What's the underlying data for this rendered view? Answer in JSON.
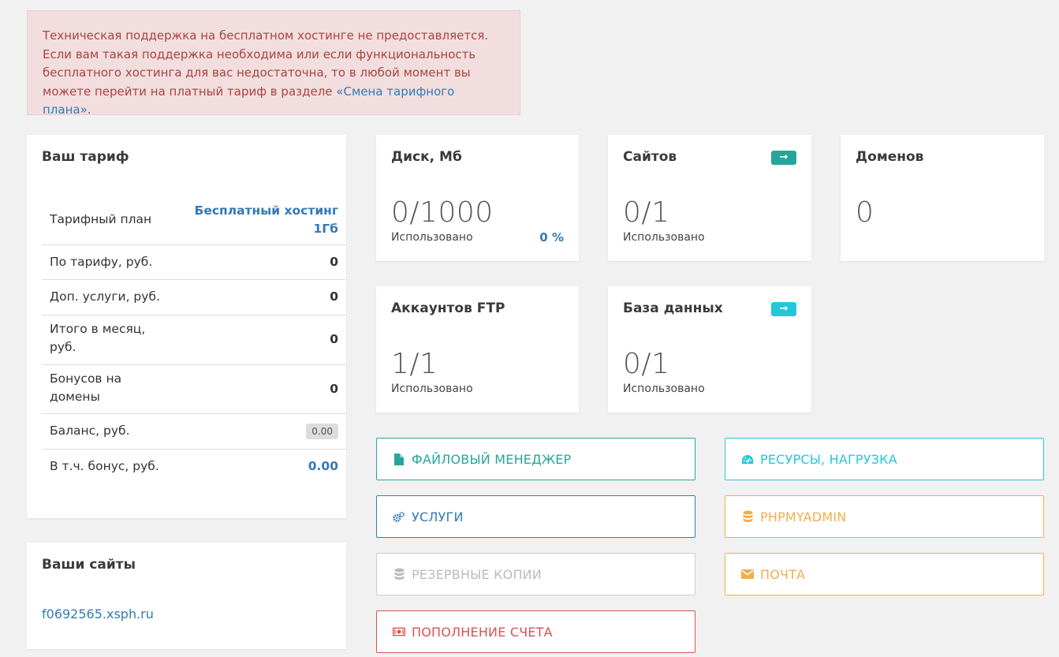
{
  "alert": {
    "line1": "Техническая поддержка на бесплатном хостинге не предоставляется.",
    "line2": "Если вам такая поддержка необходима или если функциональность",
    "line3": "бесплатного хостинга для вас недостаточна, то в любой момент вы",
    "line4_prefix": "можете перейти на платный тариф в разделе ",
    "line4_link": "«Смена тарифного плана»",
    "line4_suffix": "."
  },
  "tariff": {
    "title": "Ваш тариф",
    "plan_label": "Тарифный план",
    "plan_value_line1": "Бесплатный хостинг",
    "plan_value_line2": "1Гб",
    "rows": [
      {
        "label": "По тарифу, руб.",
        "value": "0"
      },
      {
        "label": "Доп. услуги, руб.",
        "value": "0"
      },
      {
        "label_line1": "Итого в месяц,",
        "label_line2": "руб.",
        "value": "0"
      },
      {
        "label_line1": "Бонусов на",
        "label_line2": "домены",
        "value": "0"
      },
      {
        "label": "Баланс, руб.",
        "value": "0.00"
      },
      {
        "label": "В т.ч. бонус, руб.",
        "value": "0.00"
      }
    ]
  },
  "sites_panel": {
    "title": "Ваши сайты",
    "site": "f0692565.xsph.ru"
  },
  "stats": {
    "disk": {
      "title": "Диск, Мб",
      "value": "0/1000",
      "sub": "Использовано",
      "pct": "0 %"
    },
    "sites": {
      "title": "Сайтов",
      "value": "0/1",
      "sub": "Использовано"
    },
    "domains": {
      "title": "Доменов",
      "value": "0"
    },
    "ftp": {
      "title": "Аккаунтов FTP",
      "value": "1/1",
      "sub": "Использовано"
    },
    "db": {
      "title": "База данных",
      "value": "0/1",
      "sub": "Использовано"
    }
  },
  "actions": {
    "file_manager": "Файловый менеджер",
    "resources": "Ресурсы, нагрузка",
    "services": "Услуги",
    "phpmyadmin": "phpMyAdmin",
    "backups": "Резервные копии",
    "mail": "Почта",
    "topup": "Пополнение счета"
  },
  "colors": {
    "teal": "#26a69a",
    "cyan": "#26c6da",
    "blue": "#337ab7",
    "orange": "#f0ad4e",
    "gray": "#bbbbbb",
    "red": "#d9534f"
  },
  "arrow_glyph": "→"
}
